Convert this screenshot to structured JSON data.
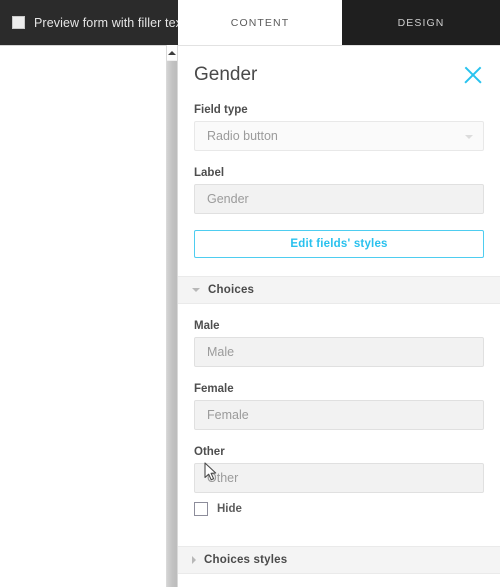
{
  "topbar": {
    "preview_checkbox_label": "Preview form with filler text",
    "preview_checked": false,
    "tabs": [
      {
        "label": "CONTENT",
        "active": true
      },
      {
        "label": "DESIGN",
        "active": false
      }
    ]
  },
  "panel": {
    "title": "Gender",
    "close_icon": "close-icon",
    "field_type": {
      "label": "Field type",
      "value": "Radio button",
      "options": [
        "Radio button"
      ]
    },
    "label_field": {
      "label": "Label",
      "value": "Gender",
      "placeholder": "Gender"
    },
    "edit_styles_button": "Edit fields' styles",
    "choices_section": {
      "title": "Choices",
      "expanded": true,
      "items": [
        {
          "label": "Male",
          "value": "Male",
          "placeholder": "Male"
        },
        {
          "label": "Female",
          "value": "Female",
          "placeholder": "Female"
        },
        {
          "label": "Other",
          "value": "Other",
          "placeholder": "Other"
        }
      ],
      "hide_label": "Hide",
      "hide_checked": false
    },
    "choices_styles_section": {
      "title": "Choices styles",
      "expanded": false
    }
  },
  "colors": {
    "accent": "#28c3ef",
    "topbar_bg": "#2b2b2b",
    "tab_inactive_bg": "#1f1f1f",
    "input_bg": "#f2f2f2",
    "section_bg": "#f4f4f4"
  },
  "scrollbar": {
    "up_arrow_icon": "scroll-up-arrow-icon"
  }
}
